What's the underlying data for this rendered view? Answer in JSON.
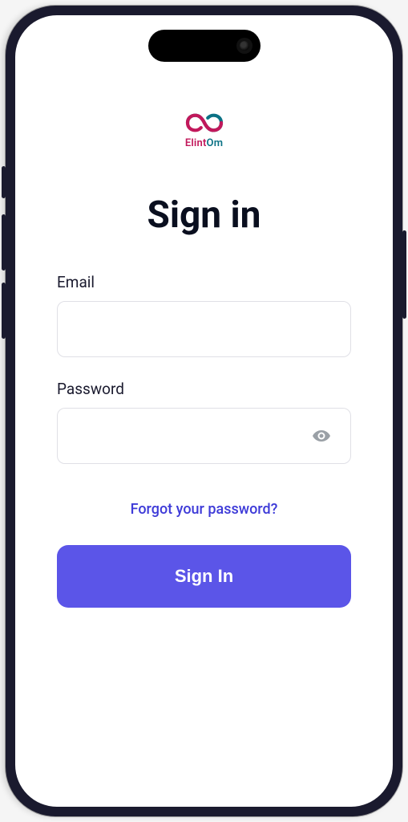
{
  "brand": {
    "name_part1": "Elint",
    "name_part2": "Om"
  },
  "page": {
    "title": "Sign in"
  },
  "form": {
    "email": {
      "label": "Email",
      "value": ""
    },
    "password": {
      "label": "Password",
      "value": ""
    },
    "forgot_text": "Forgot your password?",
    "submit_label": "Sign In"
  },
  "colors": {
    "primary": "#5b55e8",
    "link": "#3e3bd8"
  }
}
